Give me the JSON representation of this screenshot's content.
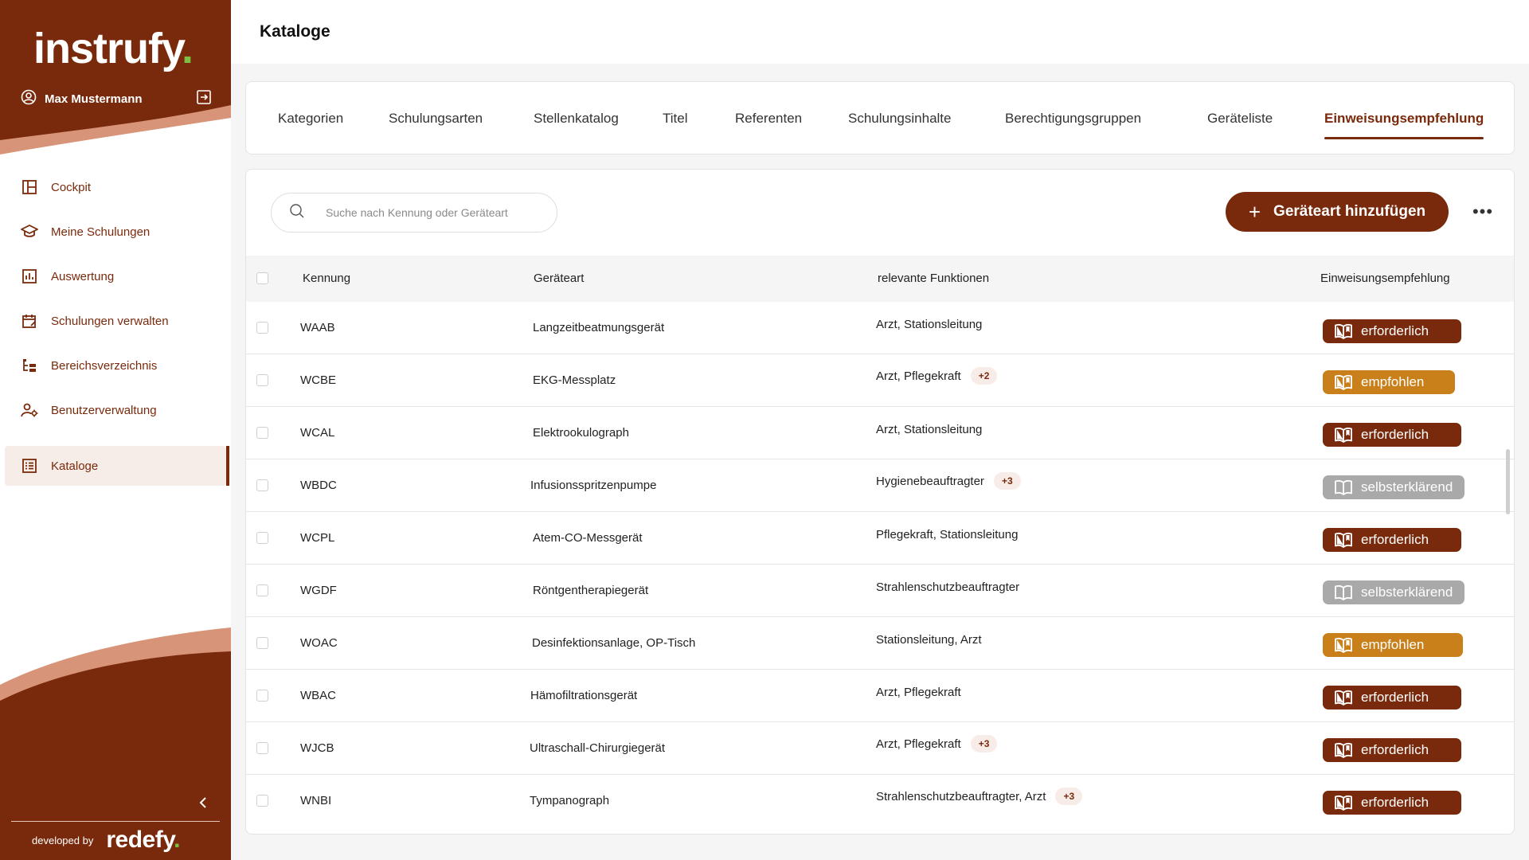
{
  "app": {
    "logo_text": "instrufy",
    "logo_dot": ".",
    "user_name": "Max Mustermann",
    "developed_by": "developed by",
    "dev_logo_text": "redefy",
    "dev_logo_dot": ".",
    "brand_color": "#7a2a0c",
    "accent_color": "#d89478"
  },
  "sidebar": {
    "items": [
      {
        "label": "Cockpit",
        "icon": "dashboard-icon"
      },
      {
        "label": "Meine Schulungen",
        "icon": "graduation-cap-icon"
      },
      {
        "label": "Auswertung",
        "icon": "bar-chart-icon"
      },
      {
        "label": "Schulungen verwalten",
        "icon": "calendar-edit-icon"
      },
      {
        "label": "Bereichsverzeichnis",
        "icon": "hierarchy-icon"
      },
      {
        "label": "Benutzerverwaltung",
        "icon": "user-settings-icon"
      },
      {
        "label": "Kataloge",
        "icon": "catalog-list-icon",
        "active": true
      }
    ]
  },
  "header": {
    "title": "Kataloge"
  },
  "tabs": [
    {
      "label": "Kategorien"
    },
    {
      "label": "Schulungsarten"
    },
    {
      "label": "Stellenkatalog"
    },
    {
      "label": "Titel"
    },
    {
      "label": "Referenten"
    },
    {
      "label": "Schulungsinhalte"
    },
    {
      "label": "Berechtigungsgruppen"
    },
    {
      "label": "Geräteliste"
    },
    {
      "label": "Einweisungsempfehlung",
      "active": true
    }
  ],
  "toolbar": {
    "search_placeholder": "Suche nach Kennung oder Geräteart",
    "add_label": "Geräteart hinzufügen",
    "more_label": "•••"
  },
  "table": {
    "headers": {
      "id": "Kennung",
      "type": "Geräteart",
      "functions": "relevante Funktionen",
      "recommendation": "Einweisungsempfehlung"
    },
    "rows": [
      {
        "id": "WAAB",
        "type": "Langzeitbeatmungsgerät",
        "functions": "Arzt, Stationsleitung",
        "extra": "",
        "rec": "erforderlich"
      },
      {
        "id": "WCBE",
        "type": "EKG-Messplatz",
        "functions": "Arzt, Pflegekraft",
        "extra": "+2",
        "rec": "empfohlen"
      },
      {
        "id": "WCAL",
        "type": "Elektrookulograph",
        "functions": "Arzt, Stationsleitung",
        "extra": "",
        "rec": "erforderlich"
      },
      {
        "id": "WBDC",
        "type": "Infusionsspritzenpumpe",
        "functions": "Hygienebeauftragter",
        "extra": "+3",
        "rec": "selbsterklärend"
      },
      {
        "id": "WCPL",
        "type": "Atem-CO-Messgerät",
        "functions": "Pflegekraft, Stationsleitung",
        "extra": "",
        "rec": "erforderlich"
      },
      {
        "id": "WGDF",
        "type": "Röntgentherapiegerät",
        "functions": "Strahlenschutzbeauftragter",
        "extra": "",
        "rec": "selbsterklärend"
      },
      {
        "id": "WOAC",
        "type": "Desinfektionsanlage, OP-Tisch",
        "functions": "Stationsleitung, Arzt",
        "extra": "",
        "rec": "empfohlen"
      },
      {
        "id": "WBAC",
        "type": "Hämofiltrationsgerät",
        "functions": "Arzt, Pflegekraft",
        "extra": "",
        "rec": "erforderlich"
      },
      {
        "id": "WJCB",
        "type": "Ultraschall-Chirurgiegerät",
        "functions": "Arzt, Pflegekraft",
        "extra": "+3",
        "rec": "erforderlich"
      },
      {
        "id": "WNBI",
        "type": "Tympanograph",
        "functions": "Strahlenschutzbeauftragter, Arzt",
        "extra": "+3",
        "rec": "erforderlich"
      }
    ]
  },
  "badge_colors": {
    "erforderlich": "#7a2a0c",
    "empfohlen": "#c9801a",
    "selbsterklärend": "#a9a9a9"
  }
}
